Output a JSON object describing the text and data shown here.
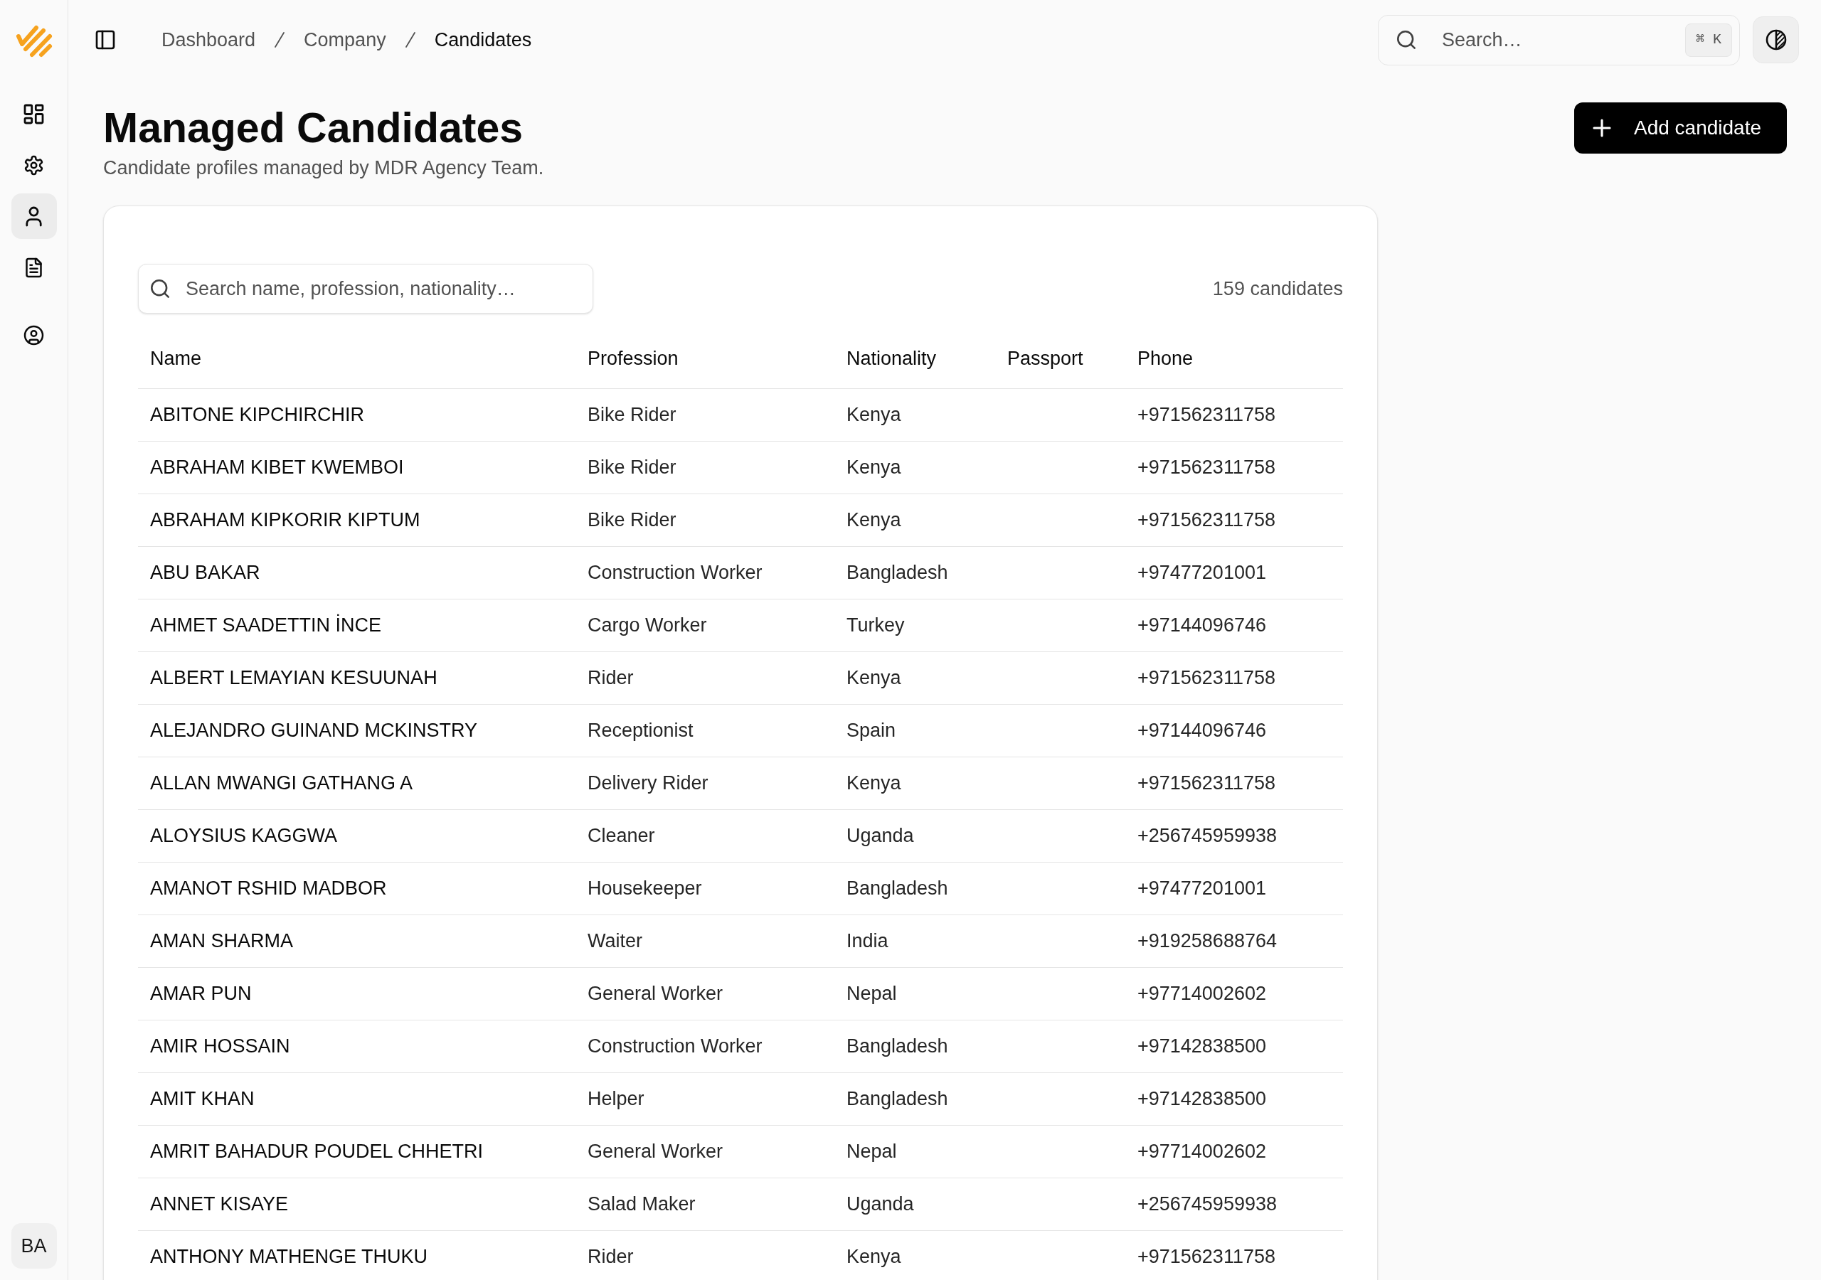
{
  "sidebar": {
    "items": [
      {
        "kind": "grid",
        "selected": false
      },
      {
        "kind": "gear",
        "selected": false
      },
      {
        "kind": "person",
        "selected": true
      },
      {
        "kind": "document",
        "selected": false
      }
    ],
    "secondary_items": [
      {
        "kind": "account",
        "selected": false
      }
    ],
    "user_initials": "BA"
  },
  "top_bar": {
    "breadcrumb": [
      {
        "label": "Dashboard",
        "current": false
      },
      {
        "label": "Company",
        "current": false
      },
      {
        "label": "Candidates",
        "current": true
      }
    ],
    "search": {
      "placeholder": "Search…",
      "shortcut": "⌘ K"
    }
  },
  "page_header": {
    "title": "Managed Candidates",
    "subtitle": "Candidate profiles managed by MDR Agency Team.",
    "primary_action": {
      "label": "Add candidate"
    }
  },
  "table": {
    "search": {
      "placeholder": "Search name, profession, nationality…"
    },
    "count": "159 candidates",
    "columns": [
      "Name",
      "Profession",
      "Nationality",
      "Passport",
      "Phone"
    ],
    "rows": [
      {
        "name": "ABITONE KIPCHIRCHIR",
        "profession": "Bike Rider",
        "nationality": "Kenya",
        "phone": "+971562311758"
      },
      {
        "name": "ABRAHAM KIBET KWEMBOI",
        "profession": "Bike Rider",
        "nationality": "Kenya",
        "phone": "+971562311758"
      },
      {
        "name": "ABRAHAM KIPKORIR KIPTUM",
        "profession": "Bike Rider",
        "nationality": "Kenya",
        "phone": "+971562311758"
      },
      {
        "name": "ABU BAKAR",
        "profession": "Construction Worker",
        "nationality": "Bangladesh",
        "phone": "+97477201001"
      },
      {
        "name": "AHMET SAADETTIN İNCE",
        "profession": "Cargo Worker",
        "nationality": "Turkey",
        "phone": "+97144096746"
      },
      {
        "name": "ALBERT LEMAYIAN KESUUNAH",
        "profession": "Rider",
        "nationality": "Kenya",
        "phone": "+971562311758"
      },
      {
        "name": "ALEJANDRO GUINAND MCKINSTRY",
        "profession": "Receptionist",
        "nationality": "Spain",
        "phone": "+97144096746"
      },
      {
        "name": "ALLAN MWANGI GATHANG A",
        "profession": "Delivery Rider",
        "nationality": "Kenya",
        "phone": "+971562311758"
      },
      {
        "name": "ALOYSIUS KAGGWA",
        "profession": "Cleaner",
        "nationality": "Uganda",
        "phone": "+256745959938"
      },
      {
        "name": "AMANOT RSHID MADBOR",
        "profession": "Housekeeper",
        "nationality": "Bangladesh",
        "phone": "+97477201001"
      },
      {
        "name": "AMAN SHARMA",
        "profession": "Waiter",
        "nationality": "India",
        "phone": "+919258688764"
      },
      {
        "name": "AMAR PUN",
        "profession": "General Worker",
        "nationality": "Nepal",
        "phone": "+97714002602"
      },
      {
        "name": "AMIR HOSSAIN",
        "profession": "Construction Worker",
        "nationality": "Bangladesh",
        "phone": "+97142838500"
      },
      {
        "name": "AMIT KHAN",
        "profession": "Helper",
        "nationality": "Bangladesh",
        "phone": "+97142838500"
      },
      {
        "name": "AMRIT BAHADUR POUDEL CHHETRI",
        "profession": "General Worker",
        "nationality": "Nepal",
        "phone": "+97714002602"
      },
      {
        "name": "ANNET KISAYE",
        "profession": "Salad Maker",
        "nationality": "Uganda",
        "phone": "+256745959938"
      },
      {
        "name": "ANTHONY MATHENGE THUKU",
        "profession": "Rider",
        "nationality": "Kenya",
        "phone": "+971562311758"
      }
    ]
  }
}
